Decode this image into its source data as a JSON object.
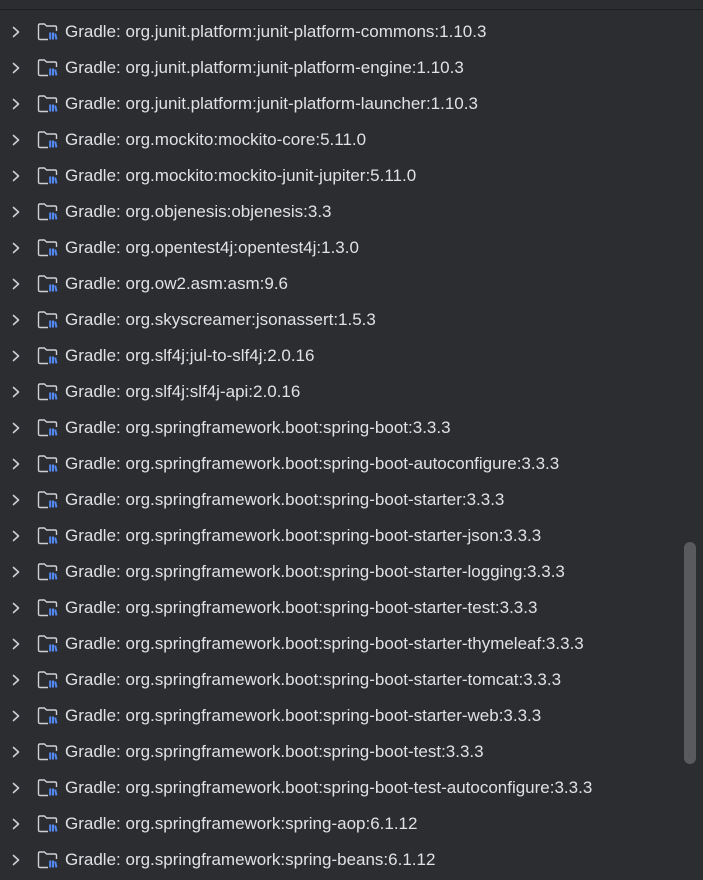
{
  "tree": {
    "items": [
      {
        "prefix": "Gradle:",
        "name": "org.junit.platform:junit-platform-commons:1.10.3"
      },
      {
        "prefix": "Gradle:",
        "name": "org.junit.platform:junit-platform-engine:1.10.3"
      },
      {
        "prefix": "Gradle:",
        "name": "org.junit.platform:junit-platform-launcher:1.10.3"
      },
      {
        "prefix": "Gradle:",
        "name": "org.mockito:mockito-core:5.11.0"
      },
      {
        "prefix": "Gradle:",
        "name": "org.mockito:mockito-junit-jupiter:5.11.0"
      },
      {
        "prefix": "Gradle:",
        "name": "org.objenesis:objenesis:3.3"
      },
      {
        "prefix": "Gradle:",
        "name": "org.opentest4j:opentest4j:1.3.0"
      },
      {
        "prefix": "Gradle:",
        "name": "org.ow2.asm:asm:9.6"
      },
      {
        "prefix": "Gradle:",
        "name": "org.skyscreamer:jsonassert:1.5.3"
      },
      {
        "prefix": "Gradle:",
        "name": "org.slf4j:jul-to-slf4j:2.0.16"
      },
      {
        "prefix": "Gradle:",
        "name": "org.slf4j:slf4j-api:2.0.16"
      },
      {
        "prefix": "Gradle:",
        "name": "org.springframework.boot:spring-boot:3.3.3"
      },
      {
        "prefix": "Gradle:",
        "name": "org.springframework.boot:spring-boot-autoconfigure:3.3.3"
      },
      {
        "prefix": "Gradle:",
        "name": "org.springframework.boot:spring-boot-starter:3.3.3"
      },
      {
        "prefix": "Gradle:",
        "name": "org.springframework.boot:spring-boot-starter-json:3.3.3"
      },
      {
        "prefix": "Gradle:",
        "name": "org.springframework.boot:spring-boot-starter-logging:3.3.3"
      },
      {
        "prefix": "Gradle:",
        "name": "org.springframework.boot:spring-boot-starter-test:3.3.3"
      },
      {
        "prefix": "Gradle:",
        "name": "org.springframework.boot:spring-boot-starter-thymeleaf:3.3.3"
      },
      {
        "prefix": "Gradle:",
        "name": "org.springframework.boot:spring-boot-starter-tomcat:3.3.3"
      },
      {
        "prefix": "Gradle:",
        "name": "org.springframework.boot:spring-boot-starter-web:3.3.3"
      },
      {
        "prefix": "Gradle:",
        "name": "org.springframework.boot:spring-boot-test:3.3.3"
      },
      {
        "prefix": "Gradle:",
        "name": "org.springframework.boot:spring-boot-test-autoconfigure:3.3.3"
      },
      {
        "prefix": "Gradle:",
        "name": "org.springframework:spring-aop:6.1.12"
      },
      {
        "prefix": "Gradle:",
        "name": "org.springframework:spring-beans:6.1.12"
      }
    ],
    "item_icon": "library-icon",
    "expander_icon": "chevron-right-icon"
  },
  "theme": {
    "background": "#2b2d30",
    "text": "#dfe1e5",
    "icon_accent": "#548af7",
    "scrollbar": "#595a5e"
  }
}
